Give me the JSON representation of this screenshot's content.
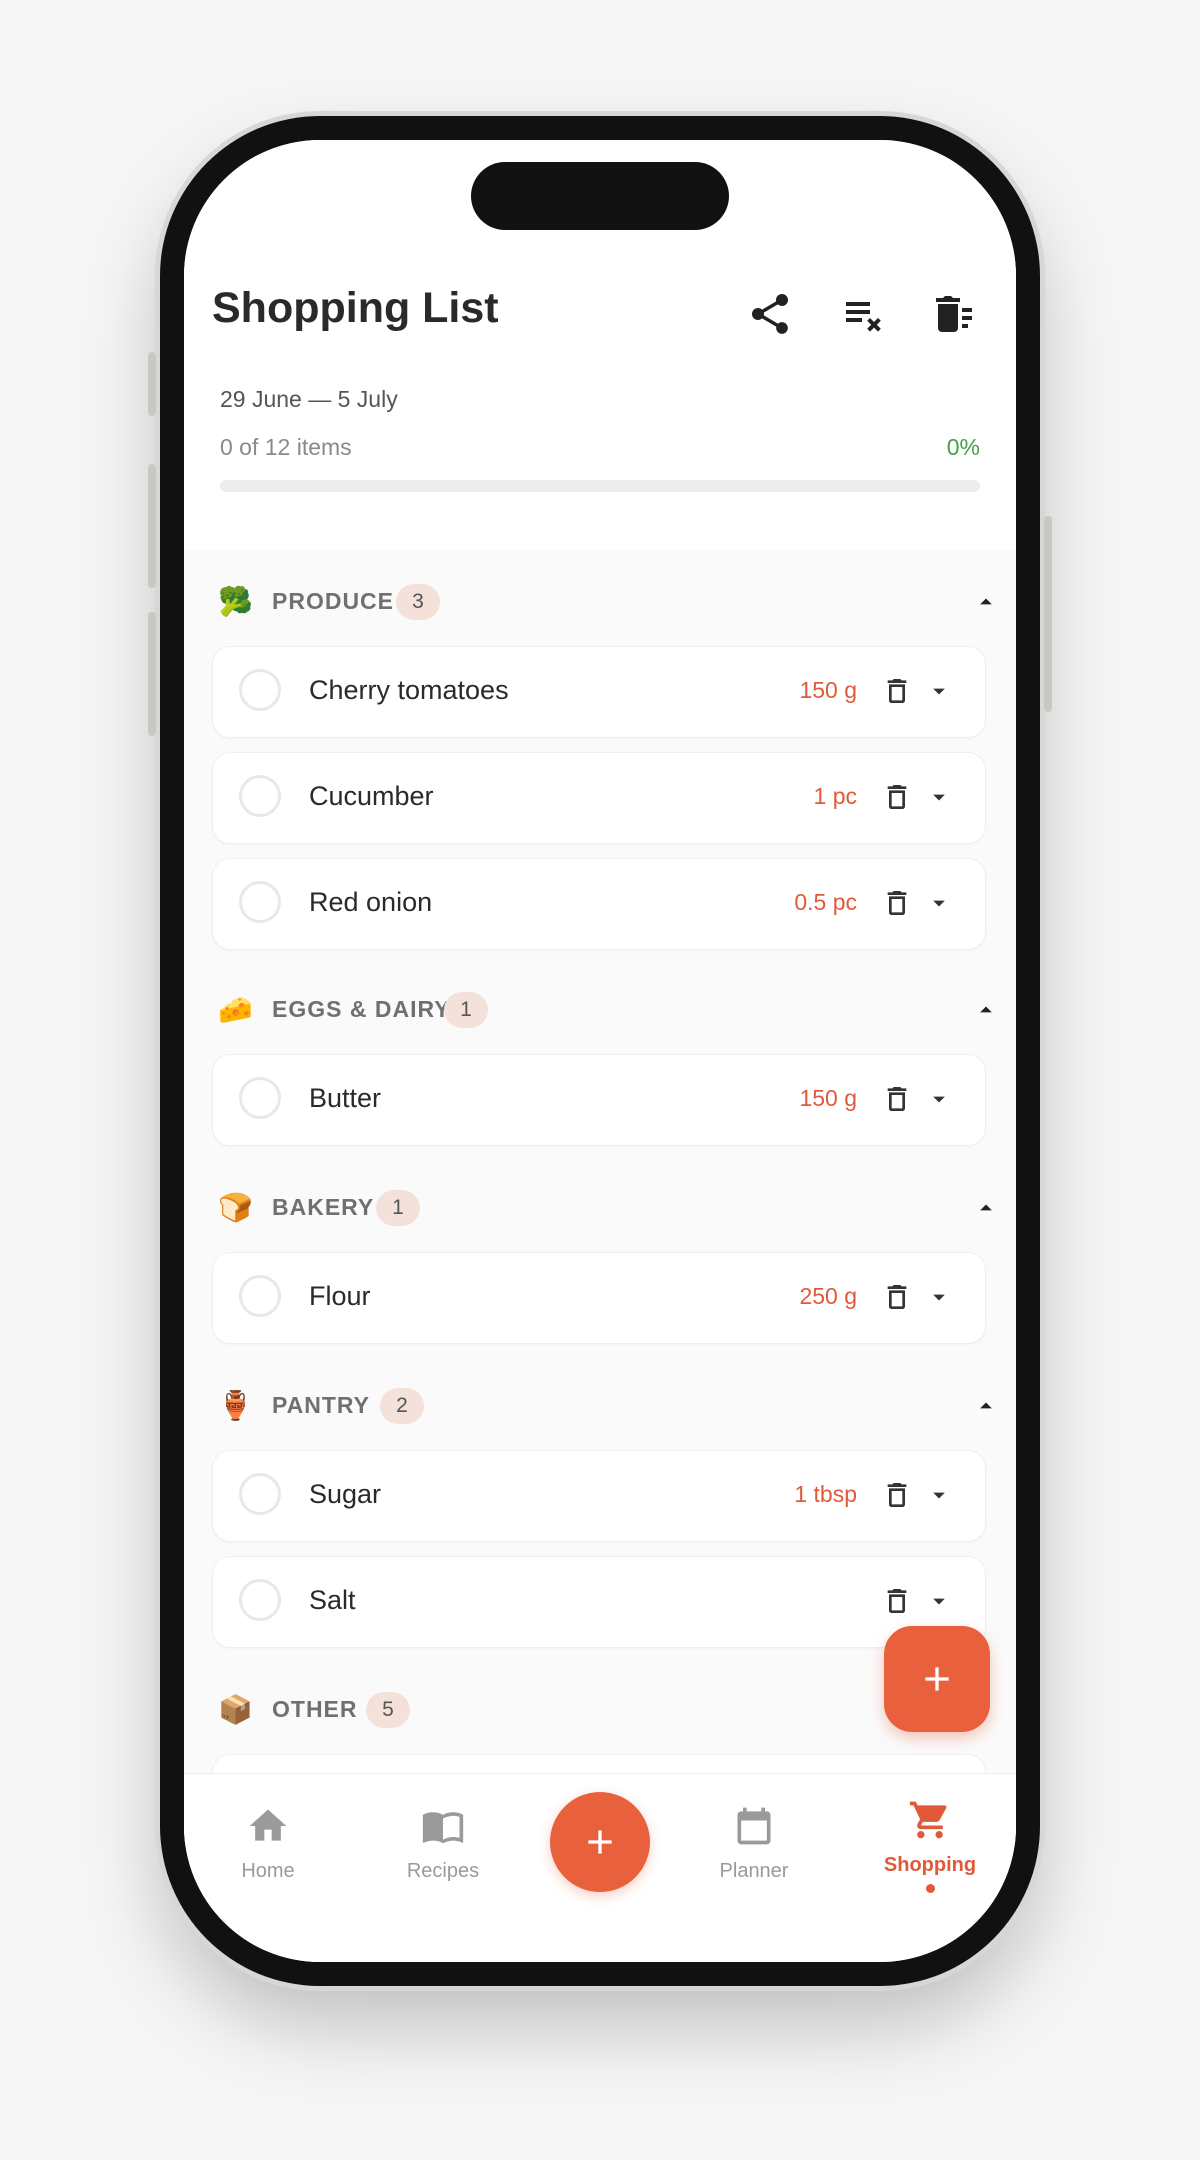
{
  "app": {
    "title": "Shopping List",
    "accent_color": "#e8603c",
    "success_color": "#43a047"
  },
  "header": {
    "date_range": "29 June — 5 July",
    "items_count": "0 of 12 items",
    "progress_percent": "0%",
    "progress_fraction": 0,
    "actions": [
      {
        "icon": "share-icon"
      },
      {
        "icon": "clear-checked-icon"
      },
      {
        "icon": "delete-all-icon"
      }
    ]
  },
  "categories": [
    {
      "emoji": "🥦",
      "name": "PRODUCE",
      "count": "3",
      "icon": "chevron-up-icon",
      "items": [
        {
          "name": "Cherry tomatoes",
          "qty": "150 g"
        },
        {
          "name": "Cucumber",
          "qty": "1 pc"
        },
        {
          "name": "Red onion",
          "qty": "0.5 pc"
        }
      ]
    },
    {
      "emoji": "🧀",
      "name": "EGGS & DAIRY",
      "count": "1",
      "icon": "chevron-up-icon",
      "items": [
        {
          "name": "Butter",
          "qty": "150 g"
        }
      ]
    },
    {
      "emoji": "🍞",
      "name": "BAKERY",
      "count": "1",
      "icon": "chevron-up-icon",
      "items": [
        {
          "name": "Flour",
          "qty": "250 g"
        }
      ]
    },
    {
      "emoji": "🏺",
      "name": "PANTRY",
      "count": "2",
      "icon": "chevron-up-icon",
      "items": [
        {
          "name": "Sugar",
          "qty": "1 tbsp"
        },
        {
          "name": "Salt",
          "qty": ""
        }
      ]
    },
    {
      "emoji": "📦",
      "name": "OTHER",
      "count": "5",
      "icon": "chevron-up-icon",
      "items": []
    }
  ],
  "fab": {
    "icon": "plus-icon"
  },
  "nav": {
    "items": [
      {
        "label": "Home",
        "icon": "home-icon",
        "active": false
      },
      {
        "label": "Recipes",
        "icon": "book-icon",
        "active": false
      },
      {
        "label": "Planner",
        "icon": "calendar-icon",
        "active": false
      },
      {
        "label": "Shopping",
        "icon": "cart-icon",
        "active": true
      }
    ],
    "center_icon": "plus-icon"
  }
}
